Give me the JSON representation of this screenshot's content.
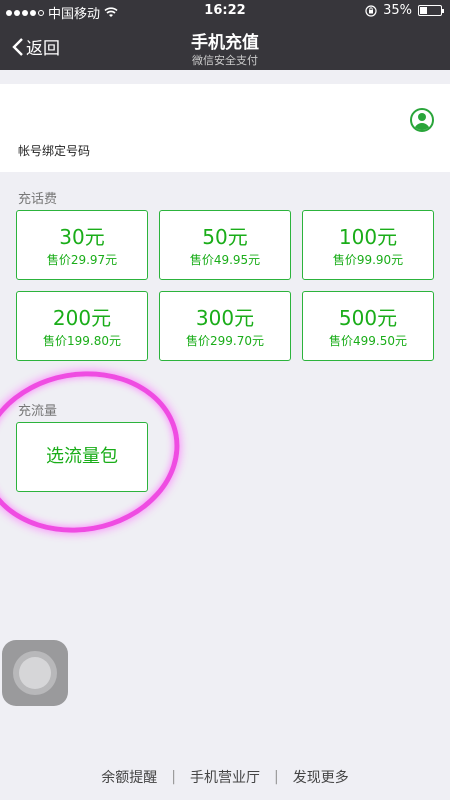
{
  "status_bar": {
    "carrier": "中国移动",
    "time": "16:22",
    "battery": "35%",
    "battery_level": 0.35
  },
  "nav": {
    "back_label": "返回",
    "title": "手机充值",
    "subtitle": "微信安全支付"
  },
  "account": {
    "label": "帐号绑定号码"
  },
  "recharge": {
    "section_label": "充话费",
    "tiles": [
      {
        "amount": "30元",
        "price": "售价29.97元"
      },
      {
        "amount": "50元",
        "price": "售价49.95元"
      },
      {
        "amount": "100元",
        "price": "售价99.90元"
      },
      {
        "amount": "200元",
        "price": "售价199.80元"
      },
      {
        "amount": "300元",
        "price": "售价299.70元"
      },
      {
        "amount": "500元",
        "price": "售价499.50元"
      }
    ]
  },
  "data_plan": {
    "section_label": "充流量",
    "button_label": "选流量包"
  },
  "footer": {
    "links": [
      "余额提醒",
      "手机营业厅",
      "发现更多"
    ]
  },
  "colors": {
    "accent": "#1aad19",
    "nav_bg": "#37363b",
    "annotation": "#f030e0"
  }
}
